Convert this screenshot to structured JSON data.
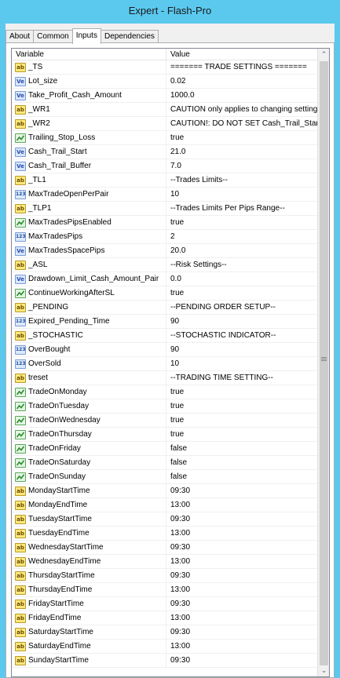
{
  "window": {
    "title": "Expert - Flash-Pro"
  },
  "tabs": [
    {
      "label": "About"
    },
    {
      "label": "Common"
    },
    {
      "label": "Inputs",
      "active": true
    },
    {
      "label": "Dependencies"
    }
  ],
  "grid": {
    "columns": {
      "variable": "Variable",
      "value": "Value"
    },
    "rows": [
      {
        "icon": "string",
        "icon_text": "ab",
        "name": "_TS",
        "value": "======= TRADE SETTINGS ======="
      },
      {
        "icon": "double",
        "icon_text": "Ve",
        "name": "Lot_size",
        "value": "0.02"
      },
      {
        "icon": "double",
        "icon_text": "Ve",
        "name": "Take_Profit_Cash_Amount",
        "value": "1000.0"
      },
      {
        "icon": "string",
        "icon_text": "ab",
        "name": "_WR1",
        "value": "CAUTION only applies to changing setting..."
      },
      {
        "icon": "string",
        "icon_text": "ab",
        "name": "_WR2",
        "value": "CAUTION!: DO NOT SET Cash_Trail_Star..."
      },
      {
        "icon": "bool",
        "icon_text": "",
        "name": "Trailing_Stop_Loss",
        "value": "true"
      },
      {
        "icon": "double",
        "icon_text": "Ve",
        "name": "Cash_Trail_Start",
        "value": "21.0"
      },
      {
        "icon": "double",
        "icon_text": "Ve",
        "name": "Cash_Trail_Buffer",
        "value": "7.0"
      },
      {
        "icon": "string",
        "icon_text": "ab",
        "name": "_TL1",
        "value": "--Trades Limits--"
      },
      {
        "icon": "int",
        "icon_text": "123",
        "name": "MaxTradeOpenPerPair",
        "value": "10"
      },
      {
        "icon": "string",
        "icon_text": "ab",
        "name": "_TLP1",
        "value": "--Trades Limits Per Pips Range--"
      },
      {
        "icon": "bool",
        "icon_text": "",
        "name": "MaxTradesPipsEnabled",
        "value": "true"
      },
      {
        "icon": "int",
        "icon_text": "123",
        "name": "MaxTradesPips",
        "value": "2"
      },
      {
        "icon": "double",
        "icon_text": "Ve",
        "name": "MaxTradesSpacePips",
        "value": "20.0"
      },
      {
        "icon": "string",
        "icon_text": "ab",
        "name": "_ASL",
        "value": "--Risk Settings--"
      },
      {
        "icon": "double",
        "icon_text": "Ve",
        "name": "Drawdown_Limit_Cash_Amount_Pair",
        "value": "0.0"
      },
      {
        "icon": "bool",
        "icon_text": "",
        "name": "ContinueWorkingAfterSL",
        "value": "true"
      },
      {
        "icon": "string",
        "icon_text": "ab",
        "name": "_PENDING",
        "value": "--PENDING ORDER SETUP--"
      },
      {
        "icon": "int",
        "icon_text": "123",
        "name": "Expired_Pending_Time",
        "value": "90"
      },
      {
        "icon": "string",
        "icon_text": "ab",
        "name": "_STOCHASTIC",
        "value": "--STOCHASTIC INDICATOR--"
      },
      {
        "icon": "int",
        "icon_text": "123",
        "name": "OverBought",
        "value": "90"
      },
      {
        "icon": "int",
        "icon_text": "123",
        "name": "OverSold",
        "value": "10"
      },
      {
        "icon": "string",
        "icon_text": "ab",
        "name": "treset",
        "value": "--TRADING TIME SETTING--"
      },
      {
        "icon": "bool",
        "icon_text": "",
        "name": "TradeOnMonday",
        "value": "true"
      },
      {
        "icon": "bool",
        "icon_text": "",
        "name": "TradeOnTuesday",
        "value": "true"
      },
      {
        "icon": "bool",
        "icon_text": "",
        "name": "TradeOnWednesday",
        "value": "true"
      },
      {
        "icon": "bool",
        "icon_text": "",
        "name": "TradeOnThursday",
        "value": "true"
      },
      {
        "icon": "bool",
        "icon_text": "",
        "name": "TradeOnFriday",
        "value": "false"
      },
      {
        "icon": "bool",
        "icon_text": "",
        "name": "TradeOnSaturday",
        "value": "false"
      },
      {
        "icon": "bool",
        "icon_text": "",
        "name": "TradeOnSunday",
        "value": "false"
      },
      {
        "icon": "string",
        "icon_text": "ab",
        "name": "MondayStartTime",
        "value": "09:30"
      },
      {
        "icon": "string",
        "icon_text": "ab",
        "name": "MondayEndTime",
        "value": "13:00"
      },
      {
        "icon": "string",
        "icon_text": "ab",
        "name": "TuesdayStartTime",
        "value": "09:30"
      },
      {
        "icon": "string",
        "icon_text": "ab",
        "name": "TuesdayEndTime",
        "value": "13:00"
      },
      {
        "icon": "string",
        "icon_text": "ab",
        "name": "WednesdayStartTime",
        "value": "09:30"
      },
      {
        "icon": "string",
        "icon_text": "ab",
        "name": "WednesdayEndTime",
        "value": "13:00"
      },
      {
        "icon": "string",
        "icon_text": "ab",
        "name": "ThursdayStartTime",
        "value": "09:30"
      },
      {
        "icon": "string",
        "icon_text": "ab",
        "name": "ThursdayEndTime",
        "value": "13:00"
      },
      {
        "icon": "string",
        "icon_text": "ab",
        "name": "FridayStartTime",
        "value": "09:30"
      },
      {
        "icon": "string",
        "icon_text": "ab",
        "name": "FridayEndTime",
        "value": "13:00"
      },
      {
        "icon": "string",
        "icon_text": "ab",
        "name": "SaturdayStartTime",
        "value": "09:30"
      },
      {
        "icon": "string",
        "icon_text": "ab",
        "name": "SaturdayEndTime",
        "value": "13:00"
      },
      {
        "icon": "string",
        "icon_text": "ab",
        "name": "SundayStartTime",
        "value": "09:30"
      }
    ]
  },
  "colors": {
    "titlebar": "#5bc8ee",
    "window_bg": "#f0f0f0",
    "grid_border": "#828790"
  }
}
